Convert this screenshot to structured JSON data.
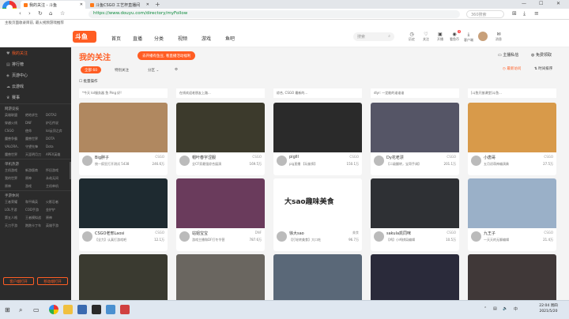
{
  "browser": {
    "tabs": [
      {
        "label": "我的关注 - 斗鱼",
        "active": true
      },
      {
        "label": "斗鱼CSGO 工艺杯直播间",
        "active": false
      }
    ],
    "new_tab": "+",
    "url": "https://www.douyu.com/directory/myFollow",
    "search_placeholder": "360搜索",
    "bookmarks": "主板页面收录目前, 最火视频游戏推荐"
  },
  "site": {
    "logo": "斗鱼",
    "nav": [
      "首页",
      "直播",
      "分类",
      "视频",
      "游戏",
      "鱼吧"
    ],
    "search_placeholder": "搜索",
    "icons": [
      {
        "label": "历史",
        "icon": "clock-icon"
      },
      {
        "label": "关注",
        "icon": "heart-icon"
      },
      {
        "label": "开播",
        "icon": "video-icon"
      },
      {
        "label": "看鱼币",
        "icon": "coin-icon",
        "badge": "4"
      },
      {
        "label": "客户端",
        "icon": "download-icon"
      },
      {
        "label": "消息",
        "icon": "message-icon"
      }
    ]
  },
  "sidebar": {
    "items": [
      {
        "label": "我的关注",
        "icon": "heart-icon",
        "active": true
      },
      {
        "label": "排行榜",
        "icon": "rank-icon"
      },
      {
        "label": "页游中心",
        "icon": "game-icon"
      },
      {
        "label": "云游戏",
        "icon": "cloud-icon"
      },
      {
        "label": "赛事",
        "icon": "trophy-icon"
      }
    ],
    "sections": [
      {
        "title": "网游竞技",
        "items": [
          "英雄联盟",
          "绝地求生",
          "DOTA2",
          "穿越火线",
          "DNF",
          "炉石传说",
          "CSGO",
          "使命",
          "lol云顶之弈",
          "魔兽争霸",
          "魔兽世界",
          "DOTA",
          "VALORA..",
          "守望先锋",
          "Dota",
          "魔兽世界",
          "天涯明月刀",
          "APEX英雄"
        ]
      },
      {
        "title": "单机热游",
        "items": [
          "主机游戏",
          "新游版商",
          "怀旧游戏",
          "我的世界",
          "原神",
          "永劫无间",
          "原神",
          "游戏",
          "主机单机"
        ]
      },
      {
        "title": "手游休闲",
        "items": [
          "王者荣耀",
          "和平精英",
          "火影忍者",
          "LOL手游",
          "COD手游",
          "金铲铲",
          "第五人格",
          "王者模拟战",
          "原神",
          "天刀手游",
          "跑跑卡丁车",
          "英雄手游"
        ]
      }
    ],
    "btn_client": "客户端打开",
    "btn_app": "移动端打开"
  },
  "main": {
    "title": "我的关注",
    "hint": "去开播有鱼豆, 看直播活动福利",
    "top_right": [
      "主播私信",
      "免费领取",
      "最新访问",
      "时间排序"
    ],
    "filters": [
      {
        "label": "全部 60",
        "active": true
      },
      {
        "label": "特别关注"
      },
      {
        "label": "分区"
      }
    ],
    "batch": "批量操作",
    "top_row": [
      "*今天 lol服务器 鱼 Ping 好!",
      "在线欢迎老朋友上路...",
      "综合, CSGO 最新的...",
      "dlyr: 一定能的谁谁谁",
      "[斗鱼开放课堂]斗鱼..."
    ],
    "cards": [
      {
        "title": "Big胖子",
        "cat": "CSGO",
        "sub": "统一疯狂打开测试 5438",
        "hot": "246.6万",
        "color": "#b08860"
      },
      {
        "title": "帽叶春字涩服",
        "cat": "CSGO",
        "sub": "全CF家最强综合展演",
        "hot": "169.5万",
        "color": "#3c3a2c"
      },
      {
        "title": "piglll",
        "cat": "CSGO",
        "sub": "pig直播 【玩偷探】",
        "hot": "150.1万",
        "color": "#2a2a2a"
      },
      {
        "title": "Dy花老漂",
        "cat": "CSGO",
        "sub": "【二级翻转，宝哥手调】",
        "hot": "201.1万",
        "color": "#555566"
      },
      {
        "title": "小唐哥",
        "cat": "CSGO",
        "sub": "五月初萌神编演奏",
        "hot": "27.5万",
        "color": "#d89a4a"
      },
      {
        "title": "CSGO老邢Laosi",
        "cat": "CSGO",
        "sub": "【全力】认真打游戏吧",
        "hot": "12.1万",
        "color": "#1e2a30"
      },
      {
        "title": "站姐宝宝",
        "cat": "DNF",
        "sub": "游戏主播和DF打冬令营",
        "hot": "787.6万",
        "color": "#6a3b5c"
      },
      {
        "title": "徐大sao",
        "cat": "美食",
        "sub": "【打轮转美食】大口吃",
        "hot": "96.7万",
        "color": "#ffffff"
      },
      {
        "title": "sakula凯同咪",
        "cat": "CSGO",
        "sub": "【鸡】小鸡棋局编辑",
        "hot": "10.5万",
        "color": "#2e3034"
      },
      {
        "title": "九王子",
        "cat": "CSGO",
        "sub": "一天天的无聊编辑",
        "hot": "21.4万",
        "color": "#9ab0c8"
      },
      {
        "title": "",
        "cat": "",
        "sub": "",
        "hot": "",
        "color": "#3a3a30"
      },
      {
        "title": "",
        "cat": "",
        "sub": "",
        "hot": "",
        "color": "#6a6660"
      },
      {
        "title": "",
        "cat": "",
        "sub": "",
        "hot": "",
        "color": "#5a6878"
      },
      {
        "title": "",
        "cat": "",
        "sub": "",
        "hot": "",
        "color": "#2a2a3a"
      },
      {
        "title": "",
        "cat": "",
        "sub": "",
        "hot": "",
        "color": "#403838"
      }
    ],
    "thumb_text": "大sao趣味美食"
  },
  "taskbar": {
    "time": "22:04 周四",
    "date": "2021/5/20"
  }
}
